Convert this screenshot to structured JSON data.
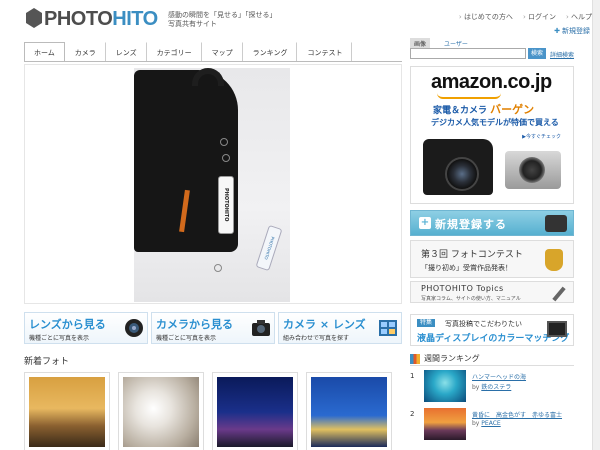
{
  "brand": {
    "name_part1": "PHOTO",
    "name_part2": "HITO",
    "tagline1": "感動の瞬間を「見せる」「探せる」",
    "tagline2": "写真共有サイト"
  },
  "header_links": [
    "はじめての方へ",
    "ログイン",
    "ヘルプ"
  ],
  "signup_link": "新規登録",
  "nav": [
    "ホーム",
    "カメラ",
    "レンズ",
    "カテゴリー",
    "マップ",
    "ランキング",
    "コンテスト"
  ],
  "search": {
    "tabs": [
      "画像",
      "ユーザー"
    ],
    "button": "検索",
    "advanced": "詳細検索",
    "value": ""
  },
  "hero": {
    "tag1": "PHOTOHITO",
    "tag2": "PHOTOHITO"
  },
  "features": [
    {
      "title": "レンズから見る",
      "sub": "機種ごとに写真を表示"
    },
    {
      "title": "カメラから見る",
      "sub": "機種ごとに写真を表示"
    },
    {
      "title": "カメラ × レンズ",
      "sub": "組み合わせで写真を探す"
    }
  ],
  "new_photos_title": "新着フォト",
  "amazon": {
    "logo": "amazon.co.jp",
    "line1a": "家電＆カメラ ",
    "line1b": "バーゲン",
    "line2": "デジカメ人気モデルが特価で買える",
    "check": "▶今すぐチェック"
  },
  "register": {
    "label": "新規登録する"
  },
  "contest": {
    "line1": "第３回 フォトコンテスト",
    "line2": "「撮り初め」受賞作品発表！"
  },
  "topics": {
    "line1": "PHOTOHITO Topics",
    "line2": "写真家コラム、サイトの使い方、マニュアル"
  },
  "display_ad": {
    "badge": "特集",
    "line1": "写真投稿でこだわりたい",
    "line2": "液晶ディスプレイのカラーマッチング"
  },
  "ranking": {
    "title": "週間ランキング",
    "items": [
      {
        "rank": "1",
        "title": "ハンマーヘッドの海",
        "by": "by ",
        "author": "鉄のステラ"
      },
      {
        "rank": "2",
        "title": "黄昏に　高金色がす　赤ゆる富士",
        "by": "by ",
        "author": "PEACE"
      }
    ]
  },
  "colors": {
    "accent": "#3b8ec2",
    "link": "#2a6fa8",
    "feature_text": "#2a8fd0"
  }
}
